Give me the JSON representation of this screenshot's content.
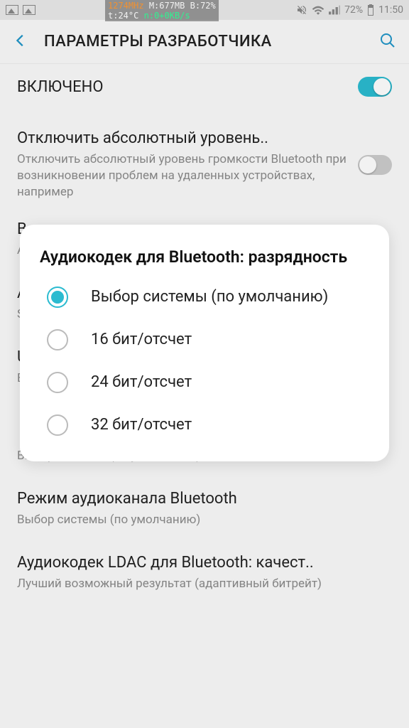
{
  "status": {
    "monitor": {
      "cpu": "1274MHz",
      "mem": "M:677MB",
      "bat": "B:72%",
      "temp": "t:24°C",
      "net": "n:0+0KB/s"
    },
    "battery": "72%",
    "time": "11:50"
  },
  "header": {
    "title": "ПАРАМЕТРЫ РАЗРАБОТЧИКА"
  },
  "rows": {
    "enabled_label": "ВКЛЮЧЕНО",
    "disable_abs": {
      "title": "Отключить абсолютный уровень..",
      "sub": "Отключить абсолютный уровень громкости Bluetooth при возникновении проблем на удаленных устройствах, например"
    },
    "row_b": {
      "title_initial": "B",
      "sub_initial": "A"
    },
    "row_a": {
      "title_initial": "A",
      "sub_initial": "S"
    },
    "row_u": {
      "title_initial": "U",
      "sub_initial": "B"
    },
    "row_bitdepth": {
      "sub": "Выбор системы (по умолчанию)"
    },
    "channel_mode": {
      "title": "Режим аудиоканала Bluetooth",
      "sub": "Выбор системы (по умолчанию)"
    },
    "ldac": {
      "title": "Аудиокодек LDAC для Bluetooth: качест..",
      "sub": "Лучший возможный результат (адаптивный битрейт)"
    }
  },
  "dialog": {
    "title": "Аудиокодек для Bluetooth: разрядность",
    "options": [
      "Выбор системы (по умолчанию)",
      "16 бит/отсчет",
      "24 бит/отсчет",
      "32 бит/отсчет"
    ]
  }
}
